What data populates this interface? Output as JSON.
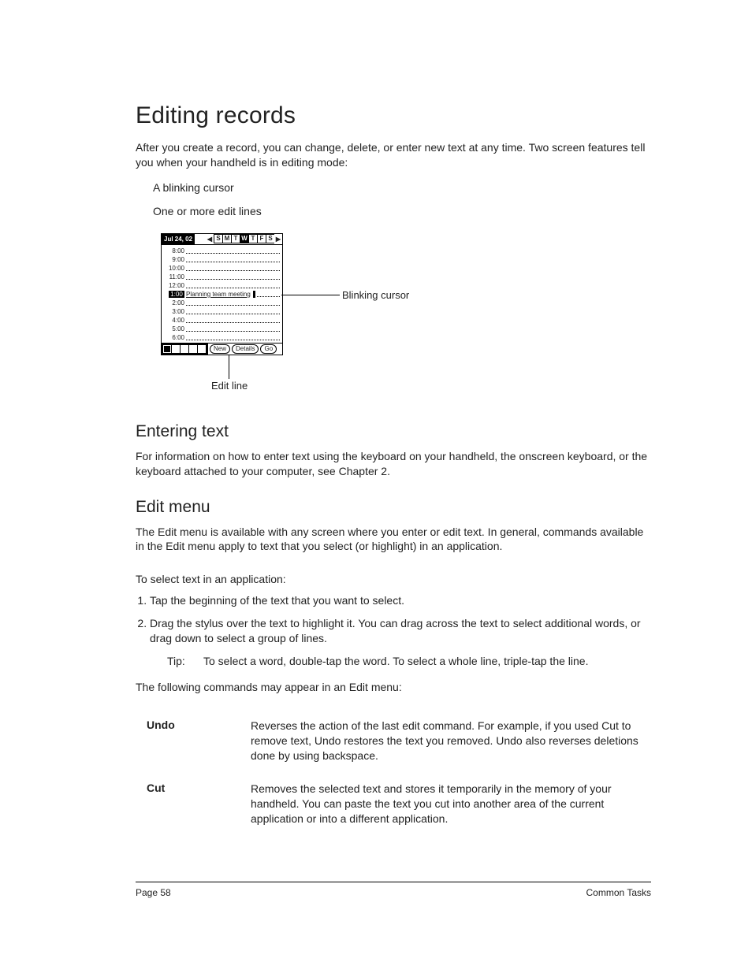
{
  "heading": "Editing records",
  "intro": "After you create a record, you can change, delete, or enter new text at any time. Two screen features tell you when your handheld is in editing mode:",
  "features": {
    "a": "A blinking cursor",
    "b": "One or more edit lines"
  },
  "device": {
    "date": "Jul 24, 02",
    "days": [
      "S",
      "M",
      "T",
      "W",
      "T",
      "F",
      "S"
    ],
    "hours": [
      "8:00",
      "9:00",
      "10:00",
      "11:00",
      "12:00",
      "1:00",
      "2:00",
      "3:00",
      "4:00",
      "5:00",
      "6:00"
    ],
    "event": "Planning team meeting",
    "buttons": {
      "new": "New",
      "details": "Details",
      "go": "Go"
    }
  },
  "callouts": {
    "cursor": "Blinking cursor",
    "editline": "Edit line"
  },
  "entering": {
    "heading": "Entering text",
    "body": "For information on how to enter text using the keyboard on your handheld, the onscreen keyboard, or the keyboard attached to your computer, see Chapter 2."
  },
  "editmenu": {
    "heading": "Edit menu",
    "body": "The Edit menu is available with any screen where you enter or edit text. In general, commands available in the Edit menu apply to text that you select (or highlight) in an application.",
    "howto": "To select text in an application:",
    "step1": "Tap the beginning of the text that you want to select.",
    "step2": "Drag the stylus over the text to highlight it. You can drag across the text to select additional words, or drag down to select a group of lines.",
    "tip_label": "Tip:",
    "tip": "To select a word, double-tap the word. To select a whole line, triple-tap the line.",
    "following": "The following commands may appear in an Edit menu:"
  },
  "commands": {
    "undo": {
      "name": "Undo",
      "desc": "Reverses the action of the last edit command. For example, if you used Cut to remove text, Undo restores the text you removed. Undo also reverses deletions done by using backspace."
    },
    "cut": {
      "name": "Cut",
      "desc": "Removes the selected text and stores it temporarily in the memory of your handheld. You can paste the text you cut into another area of the current application or into a different application."
    }
  },
  "footer": {
    "left": "Page 58",
    "right": "Common Tasks"
  }
}
